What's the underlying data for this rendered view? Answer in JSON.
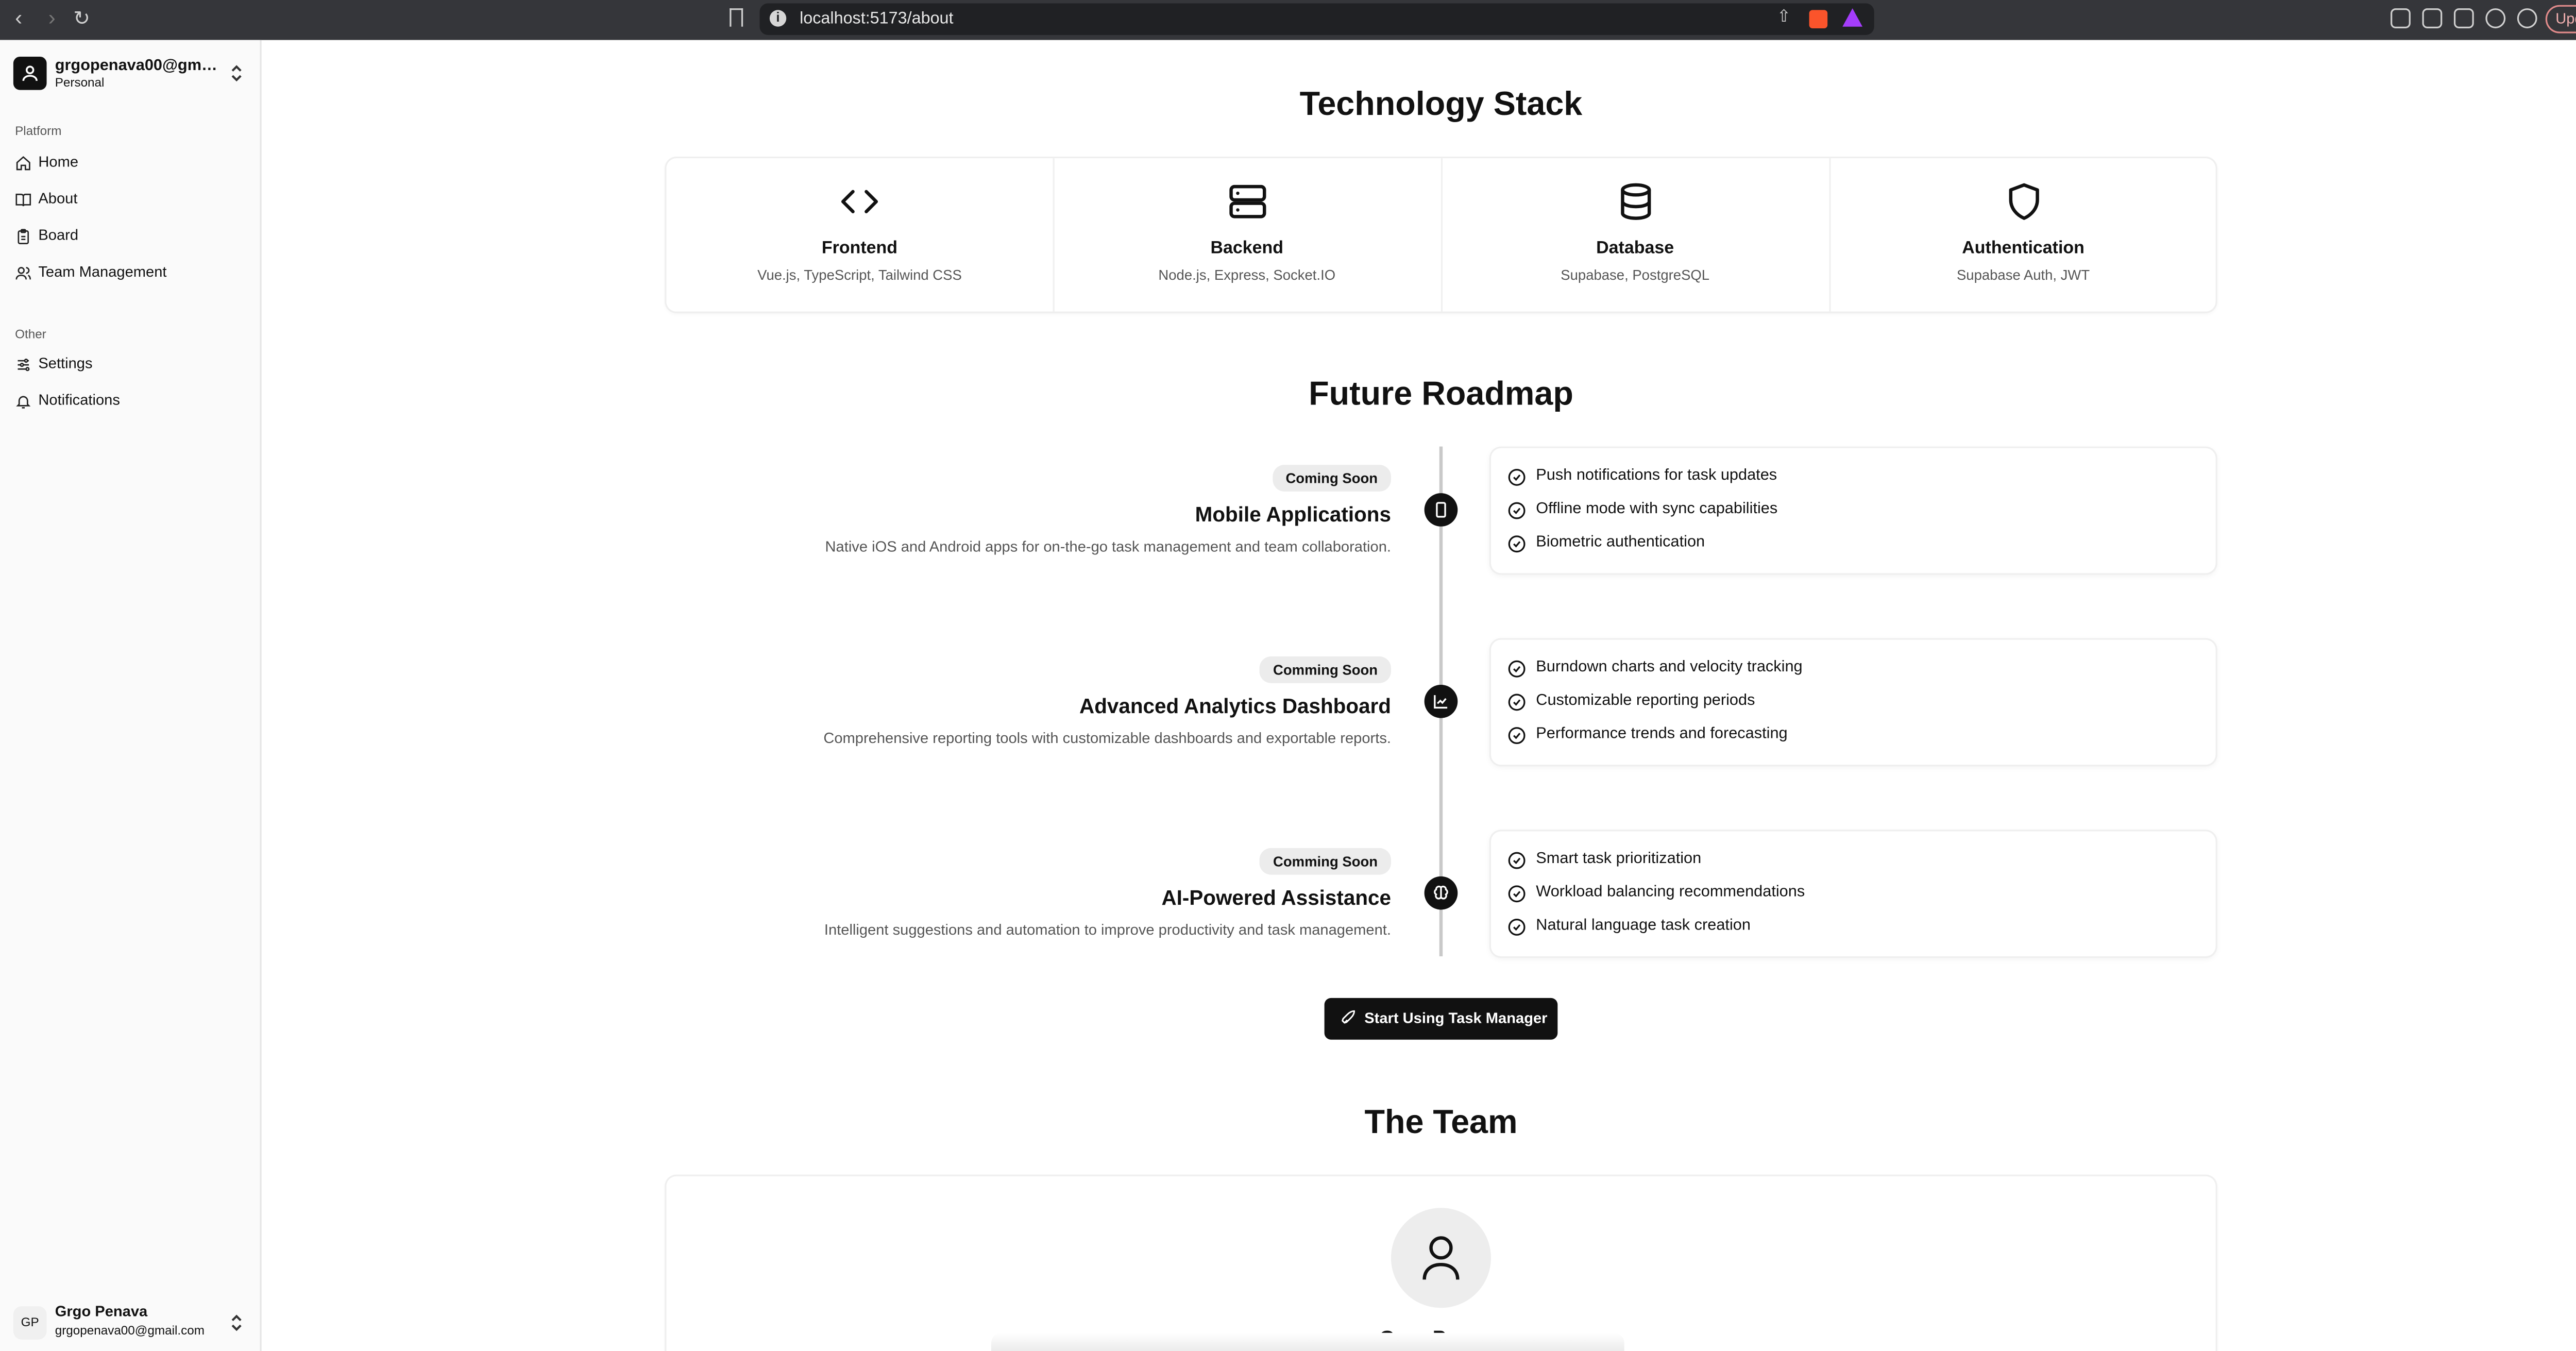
{
  "browser": {
    "url": "localhost:5173/about",
    "update_label": "Update"
  },
  "sidebar": {
    "account": {
      "name": "grgopenava00@gmai...",
      "plan": "Personal"
    },
    "groups": [
      {
        "label": "Platform",
        "items": [
          {
            "label": "Home",
            "icon": "home-icon"
          },
          {
            "label": "About",
            "icon": "book-icon"
          },
          {
            "label": "Board",
            "icon": "clipboard-icon"
          },
          {
            "label": "Team Management",
            "icon": "users-icon"
          }
        ]
      },
      {
        "label": "Other",
        "items": [
          {
            "label": "Settings",
            "icon": "sliders-icon"
          },
          {
            "label": "Notifications",
            "icon": "bell-icon"
          }
        ]
      }
    ],
    "user": {
      "initials": "GP",
      "name": "Grgo Penava",
      "email": "grgopenava00@gmail.com"
    }
  },
  "tech_stack": {
    "heading": "Technology Stack",
    "items": [
      {
        "title": "Frontend",
        "desc": "Vue.js, TypeScript, Tailwind CSS",
        "icon": "code-icon"
      },
      {
        "title": "Backend",
        "desc": "Node.js, Express, Socket.IO",
        "icon": "server-icon"
      },
      {
        "title": "Database",
        "desc": "Supabase, PostgreSQL",
        "icon": "database-icon"
      },
      {
        "title": "Authentication",
        "desc": "Supabase Auth, JWT",
        "icon": "shield-icon"
      }
    ]
  },
  "roadmap": {
    "heading": "Future Roadmap",
    "items": [
      {
        "badge": "Coming Soon",
        "title": "Mobile Applications",
        "desc": "Native iOS and Android apps for on-the-go task management and team collaboration.",
        "icon": "smartphone-icon",
        "features": [
          "Push notifications for task updates",
          "Offline mode with sync capabilities",
          "Biometric authentication"
        ]
      },
      {
        "badge": "Comming Soon",
        "title": "Advanced Analytics Dashboard",
        "desc": "Comprehensive reporting tools with customizable dashboards and exportable reports.",
        "icon": "chart-icon",
        "features": [
          "Burndown charts and velocity tracking",
          "Customizable reporting periods",
          "Performance trends and forecasting"
        ]
      },
      {
        "badge": "Comming Soon",
        "title": "AI-Powered Assistance",
        "desc": "Intelligent suggestions and automation to improve productivity and task management.",
        "icon": "brain-icon",
        "features": [
          "Smart task prioritization",
          "Workload balancing recommendations",
          "Natural language task creation"
        ]
      }
    ]
  },
  "cta": {
    "label": "Start Using Task Manager",
    "icon": "rocket-icon"
  },
  "team": {
    "heading": "The Team",
    "member_name": "Grgo Penava"
  }
}
